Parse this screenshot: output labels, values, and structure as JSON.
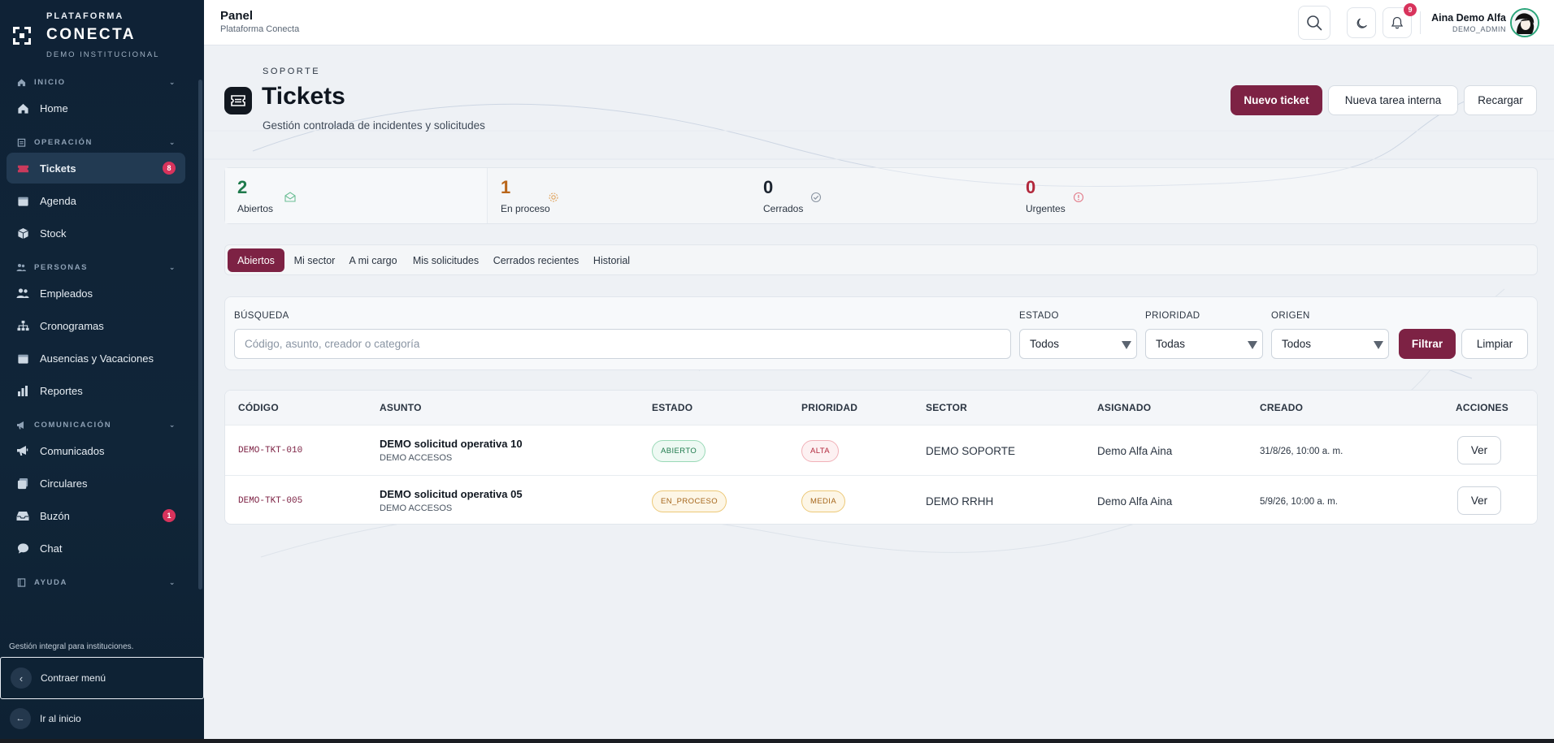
{
  "brand": {
    "top": "PLATAFORMA",
    "name": "CONECTA",
    "sub": "DEMO INSTITUCIONAL"
  },
  "sidebar": {
    "sections": [
      {
        "label": "INICIO",
        "icon": "home-icon",
        "items": [
          {
            "label": "Home",
            "icon": "house-icon"
          }
        ]
      },
      {
        "label": "OPERACIÓN",
        "icon": "clipboard-icon",
        "items": [
          {
            "label": "Tickets",
            "icon": "ticket-icon",
            "badge": "8",
            "active": true
          },
          {
            "label": "Agenda",
            "icon": "calendar-icon"
          },
          {
            "label": "Stock",
            "icon": "box-icon"
          }
        ]
      },
      {
        "label": "PERSONAS",
        "icon": "people-icon",
        "items": [
          {
            "label": "Empleados",
            "icon": "users-icon"
          },
          {
            "label": "Cronogramas",
            "icon": "sitemap-icon"
          },
          {
            "label": "Ausencias y Vacaciones",
            "icon": "calendar-icon"
          },
          {
            "label": "Reportes",
            "icon": "bar-chart-icon"
          }
        ]
      },
      {
        "label": "COMUNICACIÓN",
        "icon": "megaphone-icon",
        "items": [
          {
            "label": "Comunicados",
            "icon": "megaphone-icon"
          },
          {
            "label": "Circulares",
            "icon": "layers-icon"
          },
          {
            "label": "Buzón",
            "icon": "inbox-icon",
            "badge": "1"
          },
          {
            "label": "Chat",
            "icon": "chat-icon"
          }
        ]
      },
      {
        "label": "AYUDA",
        "icon": "book-icon",
        "items": []
      }
    ],
    "footer_text": "Gestión integral para instituciones.",
    "collapse_label": "Contraer menú",
    "home_label": "Ir al inicio"
  },
  "header": {
    "title": "Panel",
    "subtitle": "Plataforma Conecta",
    "notifications_count": "9",
    "user_name": "Aina Demo Alfa",
    "user_role": "DEMO_ADMIN"
  },
  "page": {
    "eyebrow": "SOPORTE",
    "title": "Tickets",
    "description": "Gestión controlada de incidentes y solicitudes",
    "buttons": {
      "new_ticket": "Nuevo ticket",
      "new_task": "Nueva tarea interna",
      "reload": "Recargar"
    }
  },
  "stats": [
    {
      "value": "2",
      "label": "Abiertos",
      "color": "#1f7a4c",
      "icon": "inbox-icon"
    },
    {
      "value": "1",
      "label": "En proceso",
      "color": "#b9661a",
      "icon": "gear-icon"
    },
    {
      "value": "0",
      "label": "Cerrados",
      "color": "#1c2430",
      "icon": "check-circle-icon"
    },
    {
      "value": "0",
      "label": "Urgentes",
      "color": "#b2283c",
      "icon": "alert-circle-icon"
    }
  ],
  "tabs": [
    "Abiertos",
    "Mi sector",
    "A mi cargo",
    "Mis solicitudes",
    "Cerrados recientes",
    "Historial"
  ],
  "filters": {
    "search_label": "BÚSQUEDA",
    "search_placeholder": "Código, asunto, creador o categoría",
    "status_label": "ESTADO",
    "status_value": "Todos",
    "priority_label": "PRIORIDAD",
    "priority_value": "Todas",
    "origin_label": "ORIGEN",
    "origin_value": "Todos",
    "filter_btn": "Filtrar",
    "clear_btn": "Limpiar"
  },
  "table": {
    "columns": [
      "CÓDIGO",
      "ASUNTO",
      "ESTADO",
      "PRIORIDAD",
      "SECTOR",
      "ASIGNADO",
      "CREADO",
      "ACCIONES"
    ],
    "rows": [
      {
        "code": "DEMO-TKT-010",
        "subject": "DEMO solicitud operativa 10",
        "category": "DEMO ACCESOS",
        "status": "ABIERTO",
        "priority": "ALTA",
        "sector": "DEMO SOPORTE",
        "assigned": "Demo Alfa Aina",
        "created": "31/8/26, 10:00 a. m.",
        "action": "Ver"
      },
      {
        "code": "DEMO-TKT-005",
        "subject": "DEMO solicitud operativa 05",
        "category": "DEMO ACCESOS",
        "status": "EN_PROCESO",
        "priority": "MEDIA",
        "sector": "DEMO RRHH",
        "assigned": "Demo Alfa Aina",
        "created": "5/9/26, 10:00 a. m.",
        "action": "Ver"
      }
    ]
  }
}
